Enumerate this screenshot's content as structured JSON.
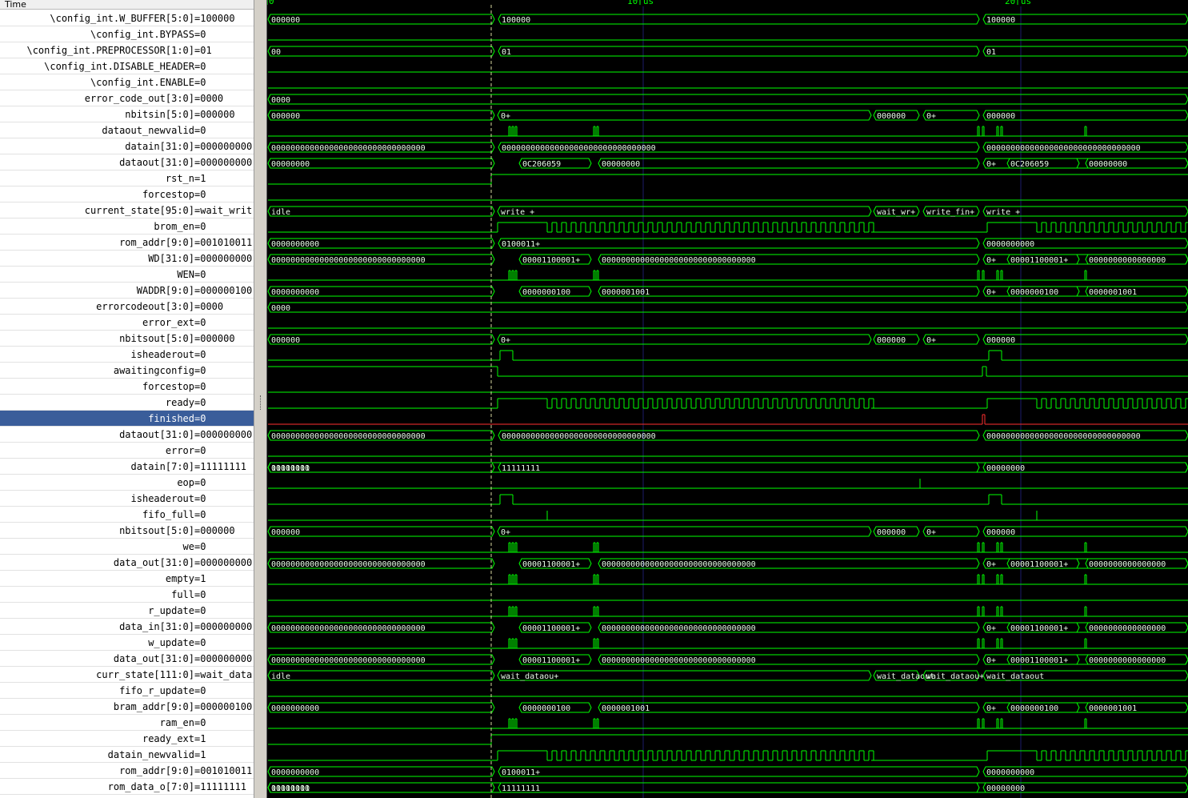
{
  "header": {
    "time_label": "Time"
  },
  "timeline": {
    "markers": [
      "0",
      "10 us",
      "20 us"
    ]
  },
  "colors": {
    "trace": "#00ff00",
    "selected_row": "#3a5d9a",
    "selected_trace": "#ff3030",
    "cursor": "#d8d8a0",
    "gridline": "#1c1c6a"
  },
  "signals": [
    {
      "name": "\\config_int.W_BUFFER[5:0]",
      "value": "=100000",
      "selected": false,
      "wave": {
        "type": "bus",
        "segs": [
          [
            "000000"
          ],
          [
            "100000"
          ],
          [
            "100000"
          ]
        ]
      }
    },
    {
      "name": "\\config_int.BYPASS",
      "value": "=0",
      "selected": false,
      "wave": {
        "type": "low"
      }
    },
    {
      "name": "\\config_int.PREPROCESSOR[1:0]",
      "value": "=01",
      "selected": false,
      "wave": {
        "type": "bus",
        "segs": [
          [
            "00"
          ],
          [
            "01"
          ],
          [
            "01"
          ]
        ]
      }
    },
    {
      "name": "\\config_int.DISABLE_HEADER",
      "value": "=0",
      "selected": false,
      "wave": {
        "type": "low"
      }
    },
    {
      "name": "\\config_int.ENABLE",
      "value": "=0",
      "selected": false,
      "wave": {
        "type": "low"
      }
    },
    {
      "name": "error_code_out[3:0]",
      "value": "=0000",
      "selected": false,
      "wave": {
        "type": "bus",
        "segs": [
          [
            "0000"
          ]
        ]
      }
    },
    {
      "name": "nbitsin[5:0]",
      "value": "=000000",
      "selected": false,
      "wave": {
        "type": "bus",
        "segs": [
          [
            "000000"
          ],
          [
            "0+"
          ],
          [
            "000000"
          ],
          [
            "0+"
          ],
          [
            "000000"
          ]
        ]
      }
    },
    {
      "name": "dataout_newvalid",
      "value": "=0",
      "selected": false,
      "wave": {
        "type": "pulses"
      }
    },
    {
      "name": "datain[31:0]",
      "value": "=000000000",
      "selected": false,
      "wave": {
        "type": "bus",
        "segs": [
          [
            "00000000000000000000000000000000"
          ],
          [
            "00000000000000000000000000000000"
          ],
          [
            "00000000000000000000000000000000"
          ]
        ]
      }
    },
    {
      "name": "dataout[31:0]",
      "value": "=000000000",
      "selected": false,
      "wave": {
        "type": "bus",
        "segs": [
          [
            "00000000"
          ],
          [
            "0C206059"
          ],
          [
            "00000000"
          ],
          [
            "0+"
          ],
          [
            "0C206059"
          ],
          [
            "00000000"
          ]
        ]
      }
    },
    {
      "name": "rst_n",
      "value": "=1",
      "selected": false,
      "wave": {
        "type": "high"
      }
    },
    {
      "name": "forcestop",
      "value": "=0",
      "selected": false,
      "wave": {
        "type": "low"
      }
    },
    {
      "name": "current_state[95:0]",
      "value": "=wait_writ",
      "selected": false,
      "wave": {
        "type": "bus",
        "segs": [
          [
            "idle"
          ],
          [
            "write +"
          ],
          [
            "wait_wr+"
          ],
          [
            "write_fin+"
          ],
          [
            "write +"
          ]
        ]
      }
    },
    {
      "name": "brom_en",
      "value": "=0",
      "selected": false,
      "wave": {
        "type": "clock"
      }
    },
    {
      "name": "rom_addr[9:0]",
      "value": "=001010011",
      "selected": false,
      "wave": {
        "type": "bus",
        "segs": [
          [
            "0000000000"
          ],
          [
            "0100011+"
          ],
          [
            "0000000000"
          ]
        ]
      }
    },
    {
      "name": "WD[31:0]",
      "value": "=000000000",
      "selected": false,
      "wave": {
        "type": "bus",
        "segs": [
          [
            "00000000000000000000000000000000"
          ],
          [
            "00001100001+"
          ],
          [
            "00000000000000000000000000000000"
          ],
          [
            "0+"
          ],
          [
            "00001100001+"
          ],
          [
            "0000000000000000"
          ]
        ]
      }
    },
    {
      "name": "WEN",
      "value": "=0",
      "selected": false,
      "wave": {
        "type": "pulses"
      }
    },
    {
      "name": "WADDR[9:0]",
      "value": "=000000100",
      "selected": false,
      "wave": {
        "type": "bus",
        "segs": [
          [
            "0000000000"
          ],
          [
            "0000000100"
          ],
          [
            "0000001001"
          ],
          [
            "0+"
          ],
          [
            "0000000100"
          ],
          [
            "0000001001"
          ]
        ]
      }
    },
    {
      "name": "errorcodeout[3:0]",
      "value": "=0000",
      "selected": false,
      "wave": {
        "type": "bus",
        "segs": [
          [
            "0000"
          ]
        ]
      }
    },
    {
      "name": "error_ext",
      "value": "=0",
      "selected": false,
      "wave": {
        "type": "low"
      }
    },
    {
      "name": "nbitsout[5:0]",
      "value": "=000000",
      "selected": false,
      "wave": {
        "type": "bus",
        "segs": [
          [
            "000000"
          ],
          [
            "0+"
          ],
          [
            "000000"
          ],
          [
            "0+"
          ],
          [
            "000000"
          ]
        ]
      }
    },
    {
      "name": "isheaderout",
      "value": "=0",
      "selected": false,
      "wave": {
        "type": "pulse2"
      }
    },
    {
      "name": "awaitingconfig",
      "value": "=0",
      "selected": false,
      "wave": {
        "type": "await"
      }
    },
    {
      "name": "forcestop",
      "value": "=0",
      "selected": false,
      "wave": {
        "type": "low"
      }
    },
    {
      "name": "ready",
      "value": "=0",
      "selected": false,
      "wave": {
        "type": "clock"
      }
    },
    {
      "name": "finished",
      "value": "=0",
      "selected": true,
      "wave": {
        "type": "finished"
      }
    },
    {
      "name": "dataout[31:0]",
      "value": "=000000000",
      "selected": false,
      "wave": {
        "type": "bus",
        "segs": [
          [
            "00000000000000000000000000000000"
          ],
          [
            "00000000000000000000000000000000"
          ],
          [
            "00000000000000000000000000000000"
          ]
        ]
      }
    },
    {
      "name": "error",
      "value": "=0",
      "selected": false,
      "wave": {
        "type": "low"
      }
    },
    {
      "name": "datain[7:0]",
      "value": "=11111111",
      "selected": false,
      "wave": {
        "type": "bus",
        "segs": [
          [
            "00000000"
          ],
          [
            "11111111"
          ],
          [
            "00000000"
          ],
          [
            "11111111"
          ]
        ]
      }
    },
    {
      "name": "eop",
      "value": "=0",
      "selected": false,
      "wave": {
        "type": "spike"
      }
    },
    {
      "name": "isheaderout",
      "value": "=0",
      "selected": false,
      "wave": {
        "type": "pulse2"
      }
    },
    {
      "name": "fifo_full",
      "value": "=0",
      "selected": false,
      "wave": {
        "type": "spike"
      }
    },
    {
      "name": "nbitsout[5:0]",
      "value": "=000000",
      "selected": false,
      "wave": {
        "type": "bus",
        "segs": [
          [
            "000000"
          ],
          [
            "0+"
          ],
          [
            "000000"
          ],
          [
            "0+"
          ],
          [
            "000000"
          ]
        ]
      }
    },
    {
      "name": "we",
      "value": "=0",
      "selected": false,
      "wave": {
        "type": "pulses"
      }
    },
    {
      "name": "data_out[31:0]",
      "value": "=000000000",
      "selected": false,
      "wave": {
        "type": "bus",
        "segs": [
          [
            "00000000000000000000000000000000"
          ],
          [
            "00001100001+"
          ],
          [
            "00000000000000000000000000000000"
          ],
          [
            "0+"
          ],
          [
            "00001100001+"
          ],
          [
            "0000000000000000"
          ]
        ]
      }
    },
    {
      "name": "empty",
      "value": "=1",
      "selected": false,
      "wave": {
        "type": "pulseslow"
      }
    },
    {
      "name": "full",
      "value": "=0",
      "selected": false,
      "wave": {
        "type": "low"
      }
    },
    {
      "name": "r_update",
      "value": "=0",
      "selected": false,
      "wave": {
        "type": "pulses"
      }
    },
    {
      "name": "data_in[31:0]",
      "value": "=000000000",
      "selected": false,
      "wave": {
        "type": "bus",
        "segs": [
          [
            "00000000000000000000000000000000"
          ],
          [
            "00001100001+"
          ],
          [
            "00000000000000000000000000000000"
          ],
          [
            "0+"
          ],
          [
            "00001100001+"
          ],
          [
            "0000000000000000"
          ]
        ]
      }
    },
    {
      "name": "w_update",
      "value": "=0",
      "selected": false,
      "wave": {
        "type": "pulses"
      }
    },
    {
      "name": "data_out[31:0]",
      "value": "=000000000",
      "selected": false,
      "wave": {
        "type": "bus",
        "segs": [
          [
            "00000000000000000000000000000000"
          ],
          [
            "00001100001+"
          ],
          [
            "00000000000000000000000000000000"
          ],
          [
            "0+"
          ],
          [
            "00001100001+"
          ],
          [
            "0000000000000000"
          ]
        ]
      }
    },
    {
      "name": "curr_state[111:0]",
      "value": "=wait_data",
      "selected": false,
      "wave": {
        "type": "bus",
        "segs": [
          [
            "idle"
          ],
          [
            "wait_dataou+"
          ],
          [
            "wait_dataout"
          ],
          [
            "wait_dataou+"
          ],
          [
            "wait_dataout"
          ]
        ]
      }
    },
    {
      "name": "fifo_r_update",
      "value": "=0",
      "selected": false,
      "wave": {
        "type": "low"
      }
    },
    {
      "name": "bram_addr[9:0]",
      "value": "=000000100",
      "selected": false,
      "wave": {
        "type": "bus",
        "segs": [
          [
            "0000000000"
          ],
          [
            "0000000100"
          ],
          [
            "0000001001"
          ],
          [
            "0+"
          ],
          [
            "0000000100"
          ],
          [
            "0000001001"
          ]
        ]
      }
    },
    {
      "name": "ram_en",
      "value": "=0",
      "selected": false,
      "wave": {
        "type": "pulses"
      }
    },
    {
      "name": "ready_ext",
      "value": "=1",
      "selected": false,
      "wave": {
        "type": "high"
      }
    },
    {
      "name": "datain_newvalid",
      "value": "=1",
      "selected": false,
      "wave": {
        "type": "clock"
      }
    },
    {
      "name": "rom_addr[9:0]",
      "value": "=001010011",
      "selected": false,
      "wave": {
        "type": "bus",
        "segs": [
          [
            "0000000000"
          ],
          [
            "0100011+"
          ],
          [
            "0000000000"
          ]
        ]
      }
    },
    {
      "name": "rom_data_o[7:0]",
      "value": "=11111111",
      "selected": false,
      "wave": {
        "type": "bus",
        "segs": [
          [
            "00000000"
          ],
          [
            "11111111"
          ],
          [
            "00000000"
          ],
          [
            "11111111"
          ]
        ]
      }
    }
  ]
}
